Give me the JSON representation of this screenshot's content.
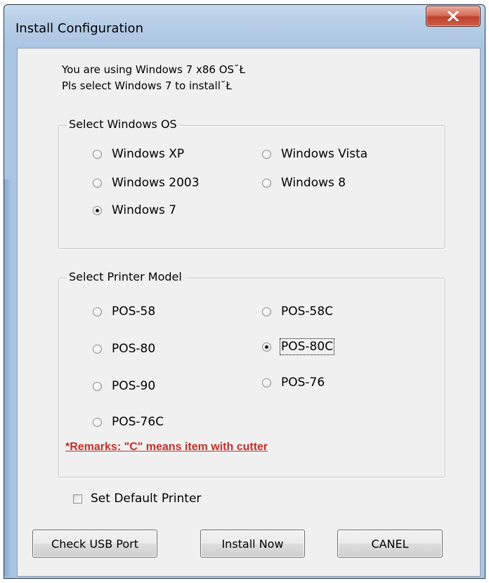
{
  "window": {
    "title": "Install Configuration",
    "close_icon": "close-x-icon"
  },
  "info": {
    "line1": "You are using Windows 7 x86 OS˘Ł",
    "line2": "Pls select Windows 7 to install˘Ł"
  },
  "os_group": {
    "legend": "Select Windows OS",
    "options": [
      {
        "label": "Windows XP",
        "selected": false
      },
      {
        "label": "Windows Vista",
        "selected": false
      },
      {
        "label": "Windows 2003",
        "selected": false
      },
      {
        "label": "Windows 8",
        "selected": false
      },
      {
        "label": "Windows 7",
        "selected": true
      }
    ]
  },
  "printer_group": {
    "legend": "Select Printer Model",
    "options": [
      {
        "label": "POS-58",
        "selected": false
      },
      {
        "label": "POS-58C",
        "selected": false
      },
      {
        "label": "POS-80",
        "selected": false
      },
      {
        "label": "POS-80C",
        "selected": true
      },
      {
        "label": "POS-90",
        "selected": false
      },
      {
        "label": "POS-76",
        "selected": false
      },
      {
        "label": "POS-76C",
        "selected": false
      }
    ],
    "remarks": "*Remarks: \"C\" means item with cutter"
  },
  "default_printer": {
    "label": "Set Default Printer",
    "checked": false
  },
  "buttons": {
    "check_usb": "Check USB Port",
    "install_now": "Install Now",
    "cancel": "CANEL"
  },
  "colors": {
    "remarks": "#c0302a",
    "close_button": "#c0402a",
    "frame": "#aac5e2"
  }
}
